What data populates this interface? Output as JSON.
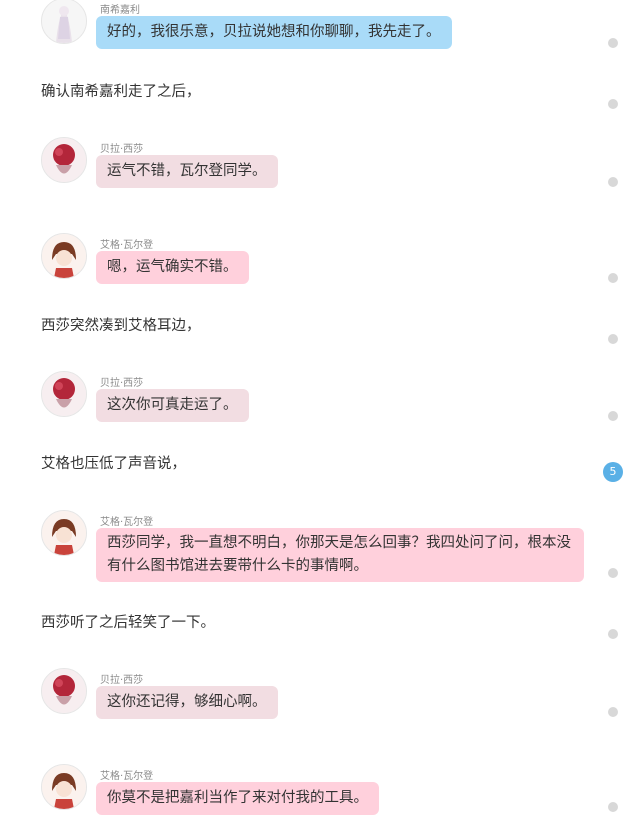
{
  "theme": {
    "bubble_blue": "#a9dbf8",
    "bubble_pink": "#ffd0dc",
    "bubble_mauve": "#f2dde2",
    "badge_color": "#5ab0e6"
  },
  "messages": [
    {
      "speaker": "南希嘉利",
      "avatar": "nancy-avatar",
      "text": "好的，我很乐意，贝拉说她想和你聊聊，我先走了。"
    },
    {
      "speaker": "贝拉·西莎",
      "avatar": "bella-avatar",
      "text": "运气不错，瓦尔登同学。"
    },
    {
      "speaker": "艾格·瓦尔登",
      "avatar": "eg-avatar",
      "text": "嗯，运气确实不错。"
    },
    {
      "speaker": "贝拉·西莎",
      "avatar": "bella-avatar",
      "text": "这次你可真走运了。"
    },
    {
      "speaker": "艾格·瓦尔登",
      "avatar": "eg-avatar",
      "text": "西莎同学，我一直想不明白，你那天是怎么回事？我四处问了问，根本没有什么图书馆进去要带什么卡的事情啊。"
    },
    {
      "speaker": "贝拉·西莎",
      "avatar": "bella-avatar",
      "text": "这你还记得，够细心啊。"
    },
    {
      "speaker": "艾格·瓦尔登",
      "avatar": "eg-avatar",
      "text": "你莫不是把嘉利当作了来对付我的工具。"
    }
  ],
  "narration": [
    "确认南希嘉利走了之后，",
    "西莎突然凑到艾格耳边，",
    "艾格也压低了声音说，",
    "西莎听了之后轻笑了一下。"
  ],
  "side_badge": "5"
}
